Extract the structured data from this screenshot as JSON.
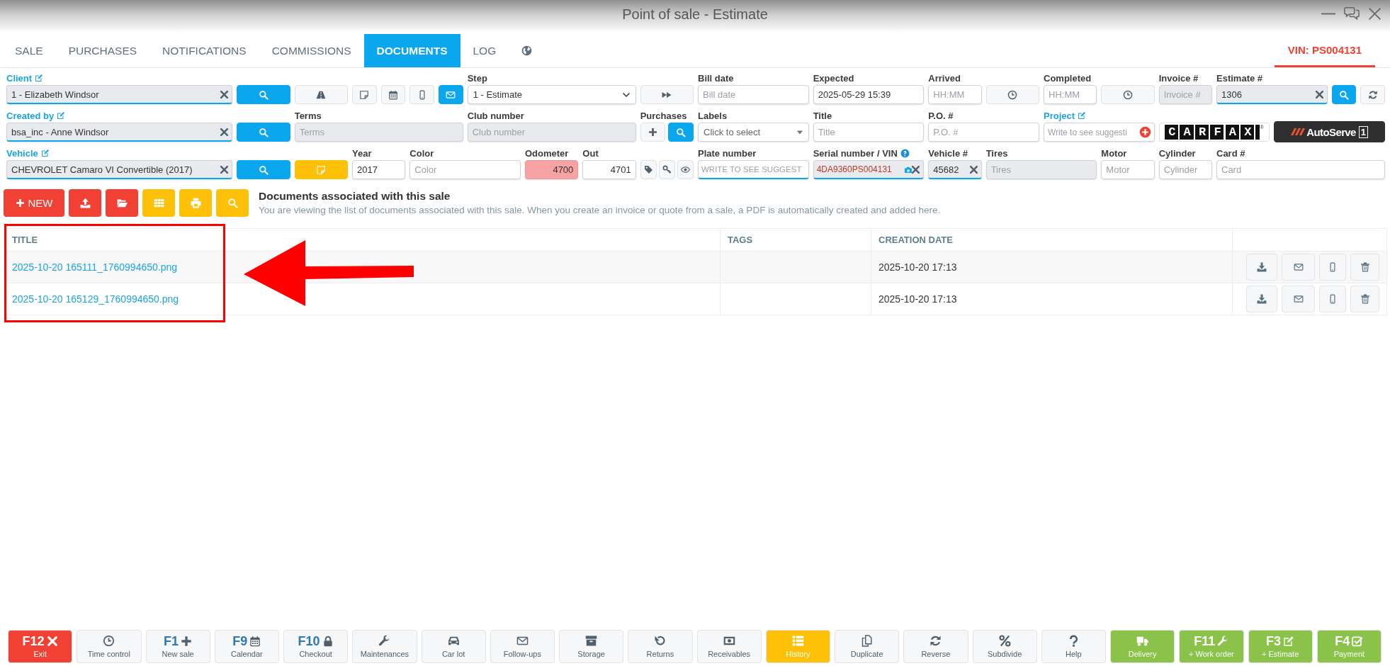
{
  "window": {
    "title": "Point of sale - Estimate"
  },
  "tabs": [
    {
      "kind": "text",
      "label": "SALE",
      "selected": false
    },
    {
      "kind": "text",
      "label": "PURCHASES",
      "selected": false
    },
    {
      "kind": "text",
      "label": "NOTIFICATIONS",
      "selected": false
    },
    {
      "kind": "text",
      "label": "COMMISSIONS",
      "selected": false
    },
    {
      "kind": "text",
      "label": "DOCUMENTS",
      "selected": true
    },
    {
      "kind": "text",
      "label": "LOG",
      "selected": false
    },
    {
      "kind": "icon",
      "selected": false
    }
  ],
  "vin_badge": "VIN: PS004131",
  "form": {
    "client": {
      "label": "Client",
      "link": true,
      "value": "1 - Elizabeth Windsor",
      "readonly": true,
      "clearable": true,
      "lookup": true
    },
    "contact_buttons": [
      {
        "selected": false
      },
      {
        "selected": false
      },
      {
        "selected": false
      },
      {
        "selected": false
      },
      {
        "selected": true
      }
    ],
    "step": {
      "label": "Step",
      "value": "1 - Estimate"
    },
    "bill_date": {
      "label": "Bill date",
      "placeholder": "Bill date"
    },
    "expected": {
      "label": "Expected",
      "value": "2025-05-29 15:39"
    },
    "arrived": {
      "label": "Arrived",
      "placeholder": "HH:MM"
    },
    "completed": {
      "label": "Completed",
      "placeholder": "HH:MM"
    },
    "invoice_number": {
      "label": "Invoice #",
      "placeholder": "Invoice #",
      "readonly": true
    },
    "estimate_number": {
      "label": "Estimate #",
      "value": "1306",
      "readonly": true,
      "clearable": true,
      "lookup": true
    },
    "created_by": {
      "label": "Created by",
      "link": true,
      "value": "bsa_inc - Anne Windsor",
      "readonly": true,
      "clearable": true,
      "lookup": true
    },
    "terms": {
      "label": "Terms",
      "placeholder": "Terms",
      "readonly": true
    },
    "club_number": {
      "label": "Club number",
      "placeholder": "Club number",
      "readonly": true
    },
    "purchases_label": "Purchases",
    "labels": {
      "label": "Labels",
      "placeholder": "Click to select"
    },
    "title": {
      "label": "Title",
      "placeholder": "Title"
    },
    "po_number": {
      "label": "P.O. #",
      "placeholder": "P.O. #"
    },
    "project": {
      "label": "Project",
      "link": true,
      "placeholder": "Write to see suggesti"
    },
    "carfax": {
      "text": "CARFAX",
      "mark": "®"
    },
    "autoserve": {
      "text": "AutoServe",
      "badge": "1"
    },
    "vehicle": {
      "label": "Vehicle",
      "link": true,
      "value": "CHEVROLET Camaro VI Convertible (2017)",
      "readonly": true,
      "clearable": true,
      "lookup": true
    },
    "year": {
      "label": "Year",
      "value": "2017"
    },
    "color": {
      "label": "Color",
      "placeholder": "Color"
    },
    "odometer": {
      "label": "Odometer",
      "value": "4700",
      "warning": true
    },
    "out": {
      "label": "Out",
      "value": "4701"
    },
    "plate_number": {
      "label": "Plate number",
      "placeholder": "WRITE TO SEE SUGGEST",
      "lookup": true
    },
    "serial_number": {
      "label": "Serial number / VIN",
      "help": true,
      "value": "4DA9360PS004131",
      "readonly": true,
      "clearable": true,
      "lookup": true,
      "invalid": true
    },
    "vehicle_number": {
      "label": "Vehicle #",
      "value": "45682",
      "readonly": true,
      "clearable": true,
      "lookup": true
    },
    "tires": {
      "label": "Tires",
      "placeholder": "Tires",
      "readonly": true
    },
    "motor": {
      "label": "Motor",
      "placeholder": "Motor"
    },
    "cylinder": {
      "label": "Cylinder",
      "placeholder": "Cylinder"
    },
    "card_number": {
      "label": "Card #",
      "placeholder": "Card"
    }
  },
  "documents": {
    "toolbar": [
      {
        "label": "NEW",
        "kind": "danger"
      },
      {
        "kind": "danger"
      },
      {
        "kind": "danger"
      },
      {
        "kind": "warning"
      },
      {
        "kind": "warning"
      },
      {
        "kind": "warning"
      }
    ],
    "title": "Documents associated with this sale",
    "description": "You are viewing the list of documents associated with this sale. When you create an invoice or quote from a sale, a PDF is automatically created and added here.",
    "table": {
      "columns": [
        "TITLE",
        "TAGS",
        "CREATION DATE"
      ],
      "rows": [
        {
          "title": "2025-10-20 165111_1760994650.png",
          "creation_date": "2025-10-20 17:13"
        },
        {
          "title": "2025-10-20 165129_1760994650.png",
          "creation_date": "2025-10-20 17:13"
        }
      ]
    }
  },
  "bottom_bar": [
    {
      "key": "F12",
      "label": "Exit",
      "kind": "danger"
    },
    {
      "label": "Time control",
      "kind": "plain"
    },
    {
      "key": "F1",
      "label": "New sale",
      "kind": "plain"
    },
    {
      "key": "F9",
      "label": "Calendar",
      "kind": "plain"
    },
    {
      "key": "F10",
      "label": "Checkout",
      "kind": "plain"
    },
    {
      "label": "Maintenances",
      "kind": "plain"
    },
    {
      "label": "Car lot",
      "kind": "plain"
    },
    {
      "label": "Follow-ups",
      "kind": "plain"
    },
    {
      "label": "Storage",
      "kind": "plain"
    },
    {
      "label": "Returns",
      "kind": "plain"
    },
    {
      "label": "Receivables",
      "kind": "plain"
    },
    {
      "label": "History",
      "kind": "warning"
    },
    {
      "label": "Duplicate",
      "kind": "plain"
    },
    {
      "label": "Reverse",
      "kind": "plain"
    },
    {
      "label": "Subdivide",
      "kind": "plain"
    },
    {
      "label": "Help",
      "kind": "plain"
    },
    {
      "label": "Delivery",
      "kind": "success"
    },
    {
      "key": "F11",
      "label": "+ Work order",
      "kind": "success"
    },
    {
      "key": "F3",
      "label": "+ Estimate",
      "kind": "success"
    },
    {
      "key": "F4",
      "label": "Payment",
      "kind": "success"
    }
  ]
}
